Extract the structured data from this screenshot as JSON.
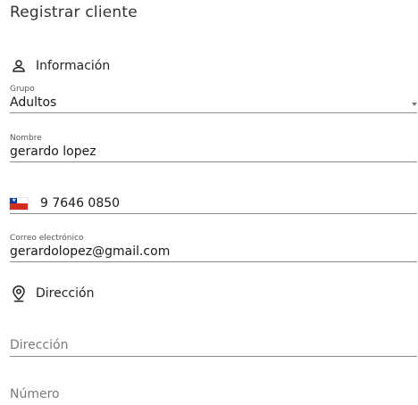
{
  "header": {
    "title": "Registrar cliente"
  },
  "sections": {
    "info": {
      "label": "Información",
      "icon": "person-icon"
    },
    "address": {
      "label": "Dirección",
      "icon": "location-pin-icon"
    }
  },
  "fields": {
    "grupo": {
      "label": "Grupo",
      "value": "Adultos"
    },
    "nombre": {
      "label": "Nombre",
      "value": "gerardo lopez"
    },
    "telefono": {
      "value": "9 7646 0850",
      "flag_icon": "chile-flag-icon"
    },
    "correo": {
      "label": "Correo electrónico",
      "value": "gerardolopez@gmail.com"
    },
    "direccion": {
      "placeholder": "Dirección"
    },
    "numero": {
      "placeholder": "Número"
    }
  },
  "colors": {
    "flag_red": "#d52b1e",
    "flag_blue": "#0039a6",
    "underline": "#8a8a8a"
  }
}
